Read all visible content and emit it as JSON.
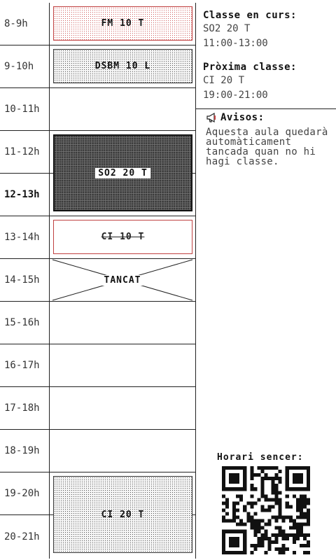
{
  "schedule": {
    "hours": [
      "8-9h",
      "9-10h",
      "10-11h",
      "11-12h",
      "12-13h",
      "13-14h",
      "14-15h",
      "15-16h",
      "16-17h",
      "17-18h",
      "18-19h",
      "19-20h",
      "20-21h"
    ],
    "current_hour_index": 4,
    "blocks": [
      {
        "label": "FM 10 T",
        "start": 0,
        "span": 1,
        "style": "dots-red"
      },
      {
        "label": "DSBM 10 L",
        "start": 1,
        "span": 1,
        "style": "dots"
      },
      {
        "label": "SO2 20 T",
        "start": 3,
        "span": 2,
        "style": "dense"
      },
      {
        "label": "CI 10 T",
        "start": 5,
        "span": 1,
        "style": "cancelled"
      },
      {
        "label": "TANCAT",
        "start": 6,
        "span": 1,
        "style": "closed"
      },
      {
        "label": "CI 20 T",
        "start": 11,
        "span": 2,
        "style": "dots"
      }
    ]
  },
  "current_class": {
    "title": "Classe en curs:",
    "name": "SO2 20 T",
    "time": "11:00-13:00"
  },
  "next_class": {
    "title": "Pròxima classe:",
    "name": "CI 20 T",
    "time": "19:00-21:00"
  },
  "notices": {
    "title": "Avisos:",
    "icon": "megaphone-icon",
    "text": "Aquesta aula quedarà automàticament tancada quan no hi hagi classe."
  },
  "full_schedule": {
    "title": "Horari sencer:",
    "icon": "qr-code-icon"
  }
}
